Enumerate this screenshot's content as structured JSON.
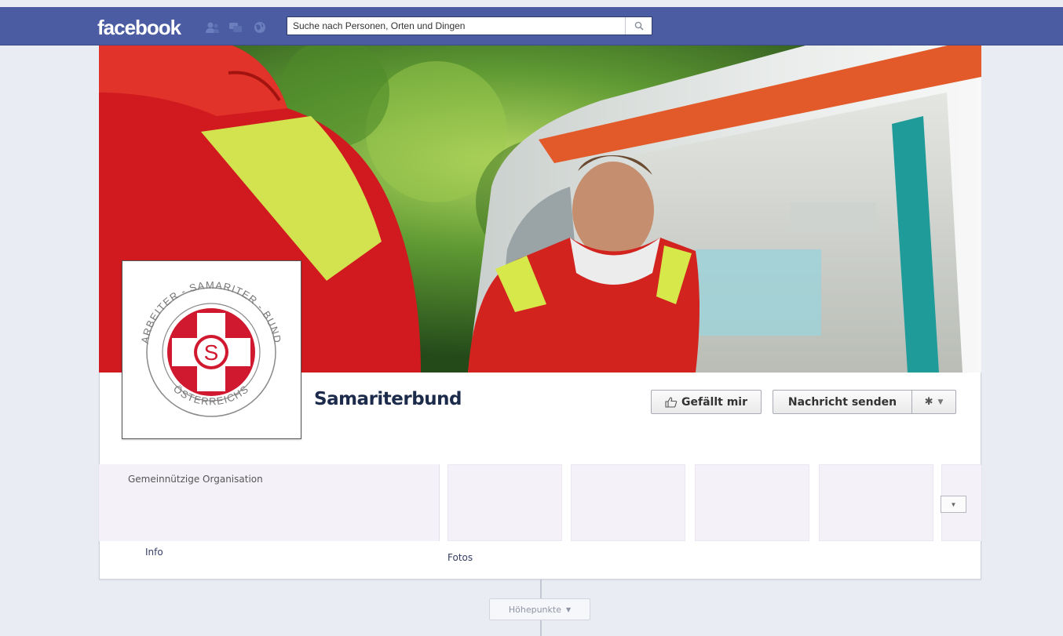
{
  "topbar": {
    "logo": "facebook",
    "search_placeholder": "Suche nach Personen, Orten und Dingen",
    "jewels": [
      "friend-requests-icon",
      "messages-icon",
      "notifications-globe-icon"
    ]
  },
  "profile": {
    "name": "Samariterbund",
    "logo_ring_top": "ARBEITER - SAMARITER - BUND",
    "logo_ring_bottom": "ÖSTERREICHS",
    "logo_letter": "S",
    "category": "Gemeinnützige Organisation"
  },
  "actions": {
    "like_label": "Gefällt mir",
    "message_label": "Nachricht senden"
  },
  "tabs": {
    "info_label": "Info",
    "photos_label": "Fotos"
  },
  "timeline": {
    "highlights_label": "Höhepunkte"
  },
  "colors": {
    "topbar": "#4b5ca2",
    "logo_red": "#d0182f",
    "page_bg": "#eaecf3"
  }
}
